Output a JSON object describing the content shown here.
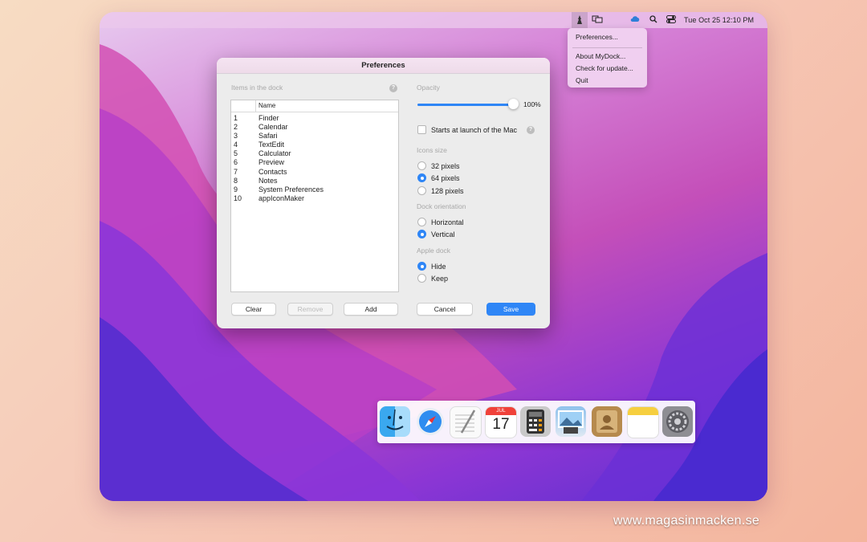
{
  "menubar": {
    "clock": "Tue Oct 25  12:10 PM",
    "icons": [
      "mydock-app-icon",
      "screens-icon",
      "cloud-icon",
      "search-icon",
      "control-center-icon"
    ]
  },
  "menu": {
    "items": [
      "Preferences...",
      "About MyDock...",
      "Check for update...",
      "Quit"
    ]
  },
  "window": {
    "title": "Preferences",
    "items_label": "Items in the dock",
    "table_header": "Name",
    "rows": [
      {
        "n": "1",
        "name": "Finder"
      },
      {
        "n": "2",
        "name": "Calendar"
      },
      {
        "n": "3",
        "name": "Safari"
      },
      {
        "n": "4",
        "name": "TextEdit"
      },
      {
        "n": "5",
        "name": "Calculator"
      },
      {
        "n": "6",
        "name": "Preview"
      },
      {
        "n": "7",
        "name": "Contacts"
      },
      {
        "n": "8",
        "name": "Notes"
      },
      {
        "n": "9",
        "name": "System Preferences"
      },
      {
        "n": "10",
        "name": "appIconMaker"
      }
    ],
    "clear": "Clear",
    "remove": "Remove",
    "add": "Add",
    "cancel": "Cancel",
    "save": "Save",
    "opacity_label": "Opacity",
    "opacity_value_text": "100%",
    "opacity_value": 1.0,
    "starts_at_launch": "Starts at launch of the Mac",
    "icons_size_label": "Icons size",
    "size_options": [
      "32 pixels",
      "64 pixels",
      "128 pixels"
    ],
    "size_selected": "64 pixels",
    "orientation_label": "Dock orientation",
    "orientation_options": [
      "Horizontal",
      "Vertical"
    ],
    "orientation_selected": "Vertical",
    "apple_dock_label": "Apple dock",
    "apple_dock_options": [
      "Hide",
      "Keep"
    ],
    "apple_dock_selected": "Hide"
  },
  "dock": {
    "icons": [
      "finder-icon",
      "safari-icon",
      "textedit-icon",
      "calendar-icon",
      "calculator-icon",
      "preview-icon",
      "contacts-icon",
      "notes-icon",
      "system-preferences-icon"
    ],
    "calendar_month": "JUL",
    "calendar_day": "17"
  },
  "watermark": "www.magasinmacken.se",
  "colors": {
    "accent": "#2f86f6"
  }
}
